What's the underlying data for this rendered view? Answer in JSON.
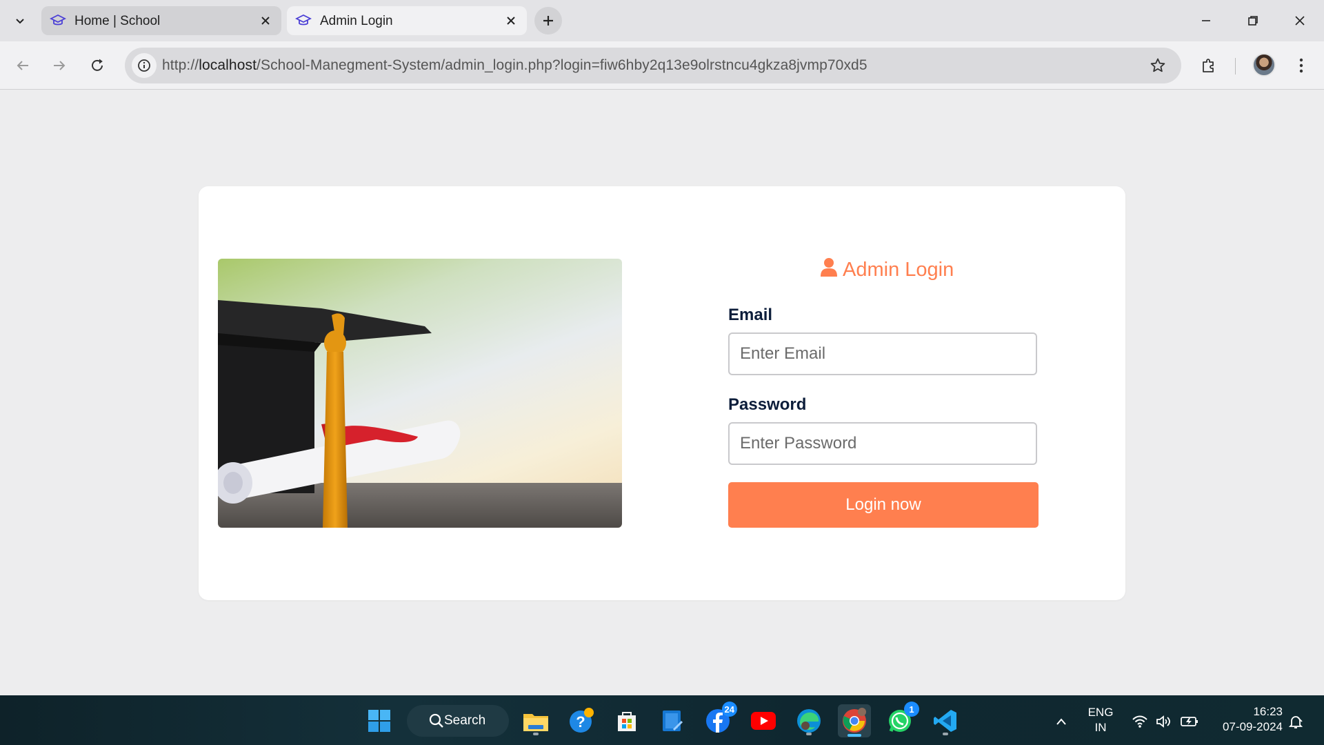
{
  "browser": {
    "tabs": [
      {
        "title": "Home | School",
        "active": false
      },
      {
        "title": "Admin Login",
        "active": true
      }
    ],
    "url_prefix": "http://",
    "url_host": "localhost",
    "url_path": "/School-Manegment-System/admin_login.php?login=fiw6hby2q13e9olrstncu4gkza8jvmp70xd5"
  },
  "login": {
    "title": "Admin Login",
    "email_label": "Email",
    "email_placeholder": "Enter Email",
    "password_label": "Password",
    "password_placeholder": "Enter Password",
    "button_label": "Login now",
    "accent_color": "#ff7f4f"
  },
  "taskbar": {
    "search_label": "Search",
    "apps": [
      {
        "name": "file-explorer-icon"
      },
      {
        "name": "help-icon"
      },
      {
        "name": "microsoft-store-icon"
      },
      {
        "name": "notepad-icon"
      },
      {
        "name": "facebook-icon",
        "badge": "24"
      },
      {
        "name": "youtube-icon"
      },
      {
        "name": "edge-icon"
      },
      {
        "name": "chrome-icon"
      },
      {
        "name": "whatsapp-icon",
        "badge": "1"
      },
      {
        "name": "vscode-icon"
      }
    ],
    "language_line1": "ENG",
    "language_line2": "IN",
    "time": "16:23",
    "date": "07-09-2024"
  }
}
